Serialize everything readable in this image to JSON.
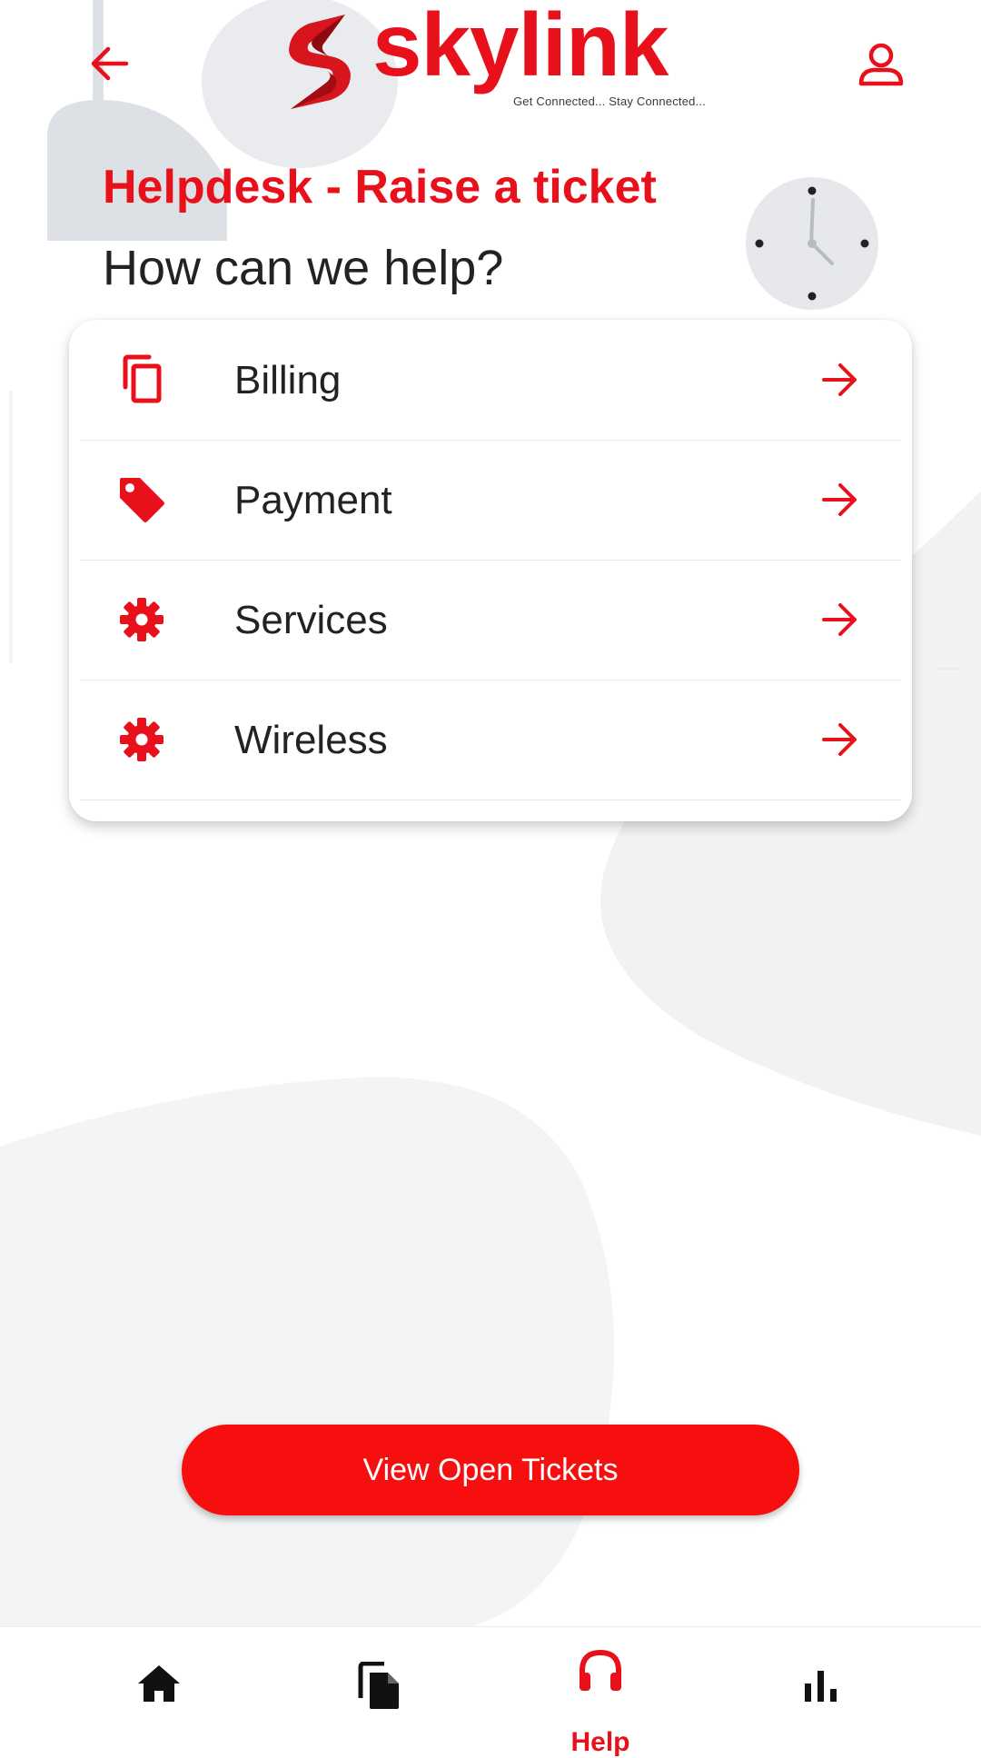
{
  "header": {
    "brand_name": "skylink",
    "brand_tagline": "Get Connected... Stay Connected...",
    "back_icon": "arrow-left-icon",
    "profile_icon": "user-icon"
  },
  "page": {
    "title": "Helpdesk - Raise a ticket",
    "subtitle": "How can we help?"
  },
  "categories": [
    {
      "label": "Billing",
      "icon": "copy-icon"
    },
    {
      "label": "Payment",
      "icon": "tag-icon"
    },
    {
      "label": "Services",
      "icon": "gear-icon"
    },
    {
      "label": "Wireless",
      "icon": "gear-icon"
    }
  ],
  "actions": {
    "view_open_tickets": "View Open Tickets"
  },
  "bottom_nav": {
    "items": [
      {
        "icon": "home-icon",
        "label": ""
      },
      {
        "icon": "documents-icon",
        "label": ""
      },
      {
        "icon": "headphones-icon",
        "label": "Help",
        "active": true
      },
      {
        "icon": "bar-chart-icon",
        "label": ""
      }
    ]
  },
  "colors": {
    "accent": "#e8101a",
    "button": "#f70f0f",
    "text": "#222222",
    "background_shape": "#f3f4f6"
  }
}
